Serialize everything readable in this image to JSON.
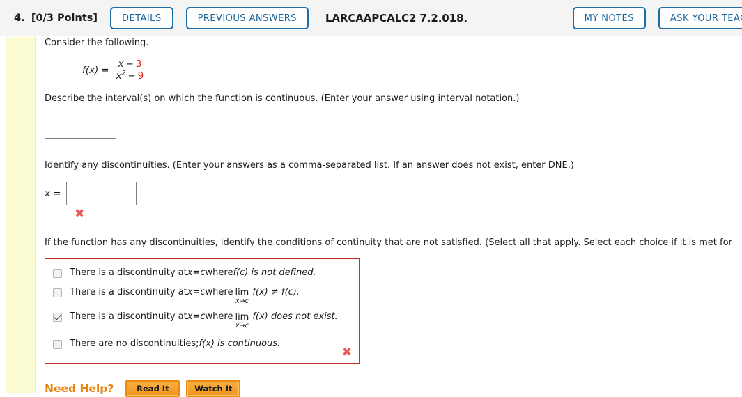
{
  "header": {
    "question_number": "4.",
    "points": "[0/3 Points]",
    "details_label": "DETAILS",
    "previous_answers_label": "PREVIOUS ANSWERS",
    "question_code": "LARCAAPCALC2 7.2.018.",
    "my_notes_label": "MY NOTES",
    "ask_teacher_label": "ASK YOUR TEACHER",
    "accent_color": "#15659c",
    "bg_color": "#f4f4f4"
  },
  "problem": {
    "consider_text": "Consider the following.",
    "function": {
      "name": "f",
      "arg": "(x)",
      "equals": "=",
      "numerator_var": "x",
      "numerator_op": "−",
      "numerator_const": "3",
      "denominator_var": "x",
      "denominator_exp": "2",
      "denominator_op": "−",
      "denominator_const": "9",
      "const_color": "#e8201a"
    }
  },
  "part_a": {
    "prompt": "Describe the interval(s) on which the function is continuous. (Enter your answer using interval notation.)",
    "input_value": ""
  },
  "part_b": {
    "prompt": "Identify any discontinuities. (Enter your answers as a comma-separated list. If an answer does not exist, enter DNE.)",
    "label": "x =",
    "input_value": "",
    "feedback_icon": "wrong-x-icon",
    "feedback_color": "#f2584f"
  },
  "part_c": {
    "prompt": "If the function has any discontinuities, identify the conditions of continuity that are not satisfied. (Select all that apply. Select each choice if it is met for",
    "border_color": "#c2302a",
    "feedback_icon": "wrong-x-icon",
    "options": [
      {
        "checked": false,
        "pre": "There is a discontinuity at ",
        "var_x": "x",
        "mid1": " = ",
        "var_c": "c",
        "mid2": " where ",
        "has_limit": false,
        "post": "f(c) is not defined."
      },
      {
        "checked": false,
        "pre": "There is a discontinuity at ",
        "var_x": "x",
        "mid1": " = ",
        "var_c": "c",
        "mid2": " where ",
        "has_limit": true,
        "limit_top": "lim",
        "limit_bottom": "x→c",
        "post": "f(x) ≠ f(c)."
      },
      {
        "checked": true,
        "pre": "There is a discontinuity at ",
        "var_x": "x",
        "mid1": " = ",
        "var_c": "c",
        "mid2": " where ",
        "has_limit": true,
        "limit_top": "lim",
        "limit_bottom": "x→c",
        "post": "f(x) does not exist."
      },
      {
        "checked": false,
        "pre": "There are no discontinuities; ",
        "var_x": "",
        "mid1": "",
        "var_c": "",
        "mid2": "",
        "has_limit": false,
        "post": "f(x) is continuous."
      }
    ]
  },
  "need_help": {
    "label": "Need Help?",
    "read_it_label": "Read It",
    "watch_it_label": "Watch It",
    "accent_color": "#e8820c"
  }
}
